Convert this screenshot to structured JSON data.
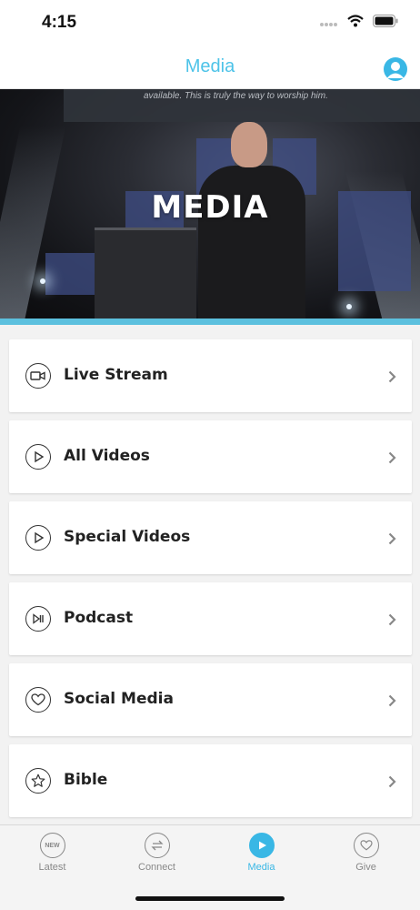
{
  "status_bar": {
    "time": "4:15"
  },
  "nav": {
    "title": "Media"
  },
  "hero": {
    "title": "MEDIA",
    "screen_text": "available. This is truly the way to worship him."
  },
  "colors": {
    "accent": "#39b7e5",
    "accent_bar": "#5cc0de",
    "title_blue": "#4dc3e8"
  },
  "menu": {
    "items": [
      {
        "label": "Live Stream",
        "icon": "video-camera-icon"
      },
      {
        "label": "All Videos",
        "icon": "play-icon"
      },
      {
        "label": "Special Videos",
        "icon": "play-icon"
      },
      {
        "label": "Podcast",
        "icon": "play-pause-icon"
      },
      {
        "label": "Social Media",
        "icon": "heart-icon"
      },
      {
        "label": "Bible",
        "icon": "star-icon"
      }
    ]
  },
  "tabs": [
    {
      "label": "Latest",
      "icon": "new-badge-icon",
      "badge": "NEW",
      "active": false
    },
    {
      "label": "Connect",
      "icon": "swap-arrows-icon",
      "active": false
    },
    {
      "label": "Media",
      "icon": "play-icon",
      "active": true
    },
    {
      "label": "Give",
      "icon": "heart-icon",
      "active": false
    }
  ]
}
